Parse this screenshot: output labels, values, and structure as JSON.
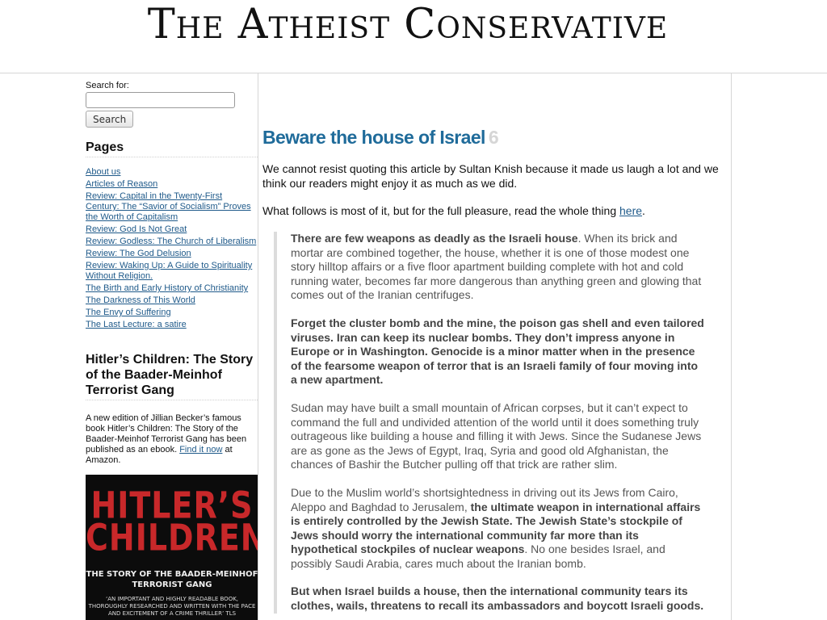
{
  "header": {
    "site_title": "The Atheist Conservative"
  },
  "sidebar": {
    "search_label": "Search for:",
    "search_value": "",
    "search_button": "Search",
    "pages_title": "Pages",
    "pages": [
      "About us",
      "Articles of Reason",
      "Review: Capital in the Twenty-First Century: The “Savior of Socialism” Proves the Worth of Capitalism",
      "Review: God Is Not Great",
      "Review: Godless: The Church of Liberalism",
      "Review: The God Delusion",
      "Review: Waking Up: A Guide to Spirituality Without Religion.",
      "The Birth and Early History of Christianity",
      "The Darkness of This World",
      "The Envy of Suffering",
      "The Last Lecture: a satire"
    ],
    "book_widget": {
      "title": "Hitler’s Children: The Story of the Baader-Meinhof Terrorist Gang",
      "desc_before": "A new edition of Jillian Becker’s famous book Hitler’s Children: The Story of the Baader-Meinhof Terrorist Gang has been published as an ebook. ",
      "desc_link": "Find it now",
      "desc_after": " at Amazon.",
      "cover": {
        "line1": "HITLER’S",
        "line2": "CHILDREN",
        "subtitle": "THE STORY OF THE BAADER-MEINHOF TERRORIST GANG",
        "quote": "‘AN IMPORTANT AND HIGHLY READABLE BOOK, THOROUGHLY RESEARCHED AND WRITTEN WITH THE PACE AND EXCITEMENT OF A CRIME THRILLER’ TLS",
        "title_color": "#c8282a"
      }
    }
  },
  "post": {
    "title": "Beware the house of Israel",
    "comment_count": "6",
    "intro1": "We cannot resist quoting this article by Sultan Knish because it made us laugh a lot and we think our readers might enjoy it as much as we did.",
    "intro2_before": "What follows is most of it, but for the full pleasure, read the whole thing ",
    "intro2_link": "here",
    "intro2_after": ".",
    "quote": {
      "p1_bold": "There are few weapons as deadly as the Israeli house",
      "p1_rest": ". When its brick and mortar are combined together, the house, whether it is one of those modest one story hilltop affairs or a five floor apartment building complete with hot and cold running water, becomes far more dangerous than anything green and glowing that comes out of the Iranian centrifuges.",
      "p2_bold": "Forget the cluster bomb and the mine, the poison gas shell and even tailored viruses. Iran can keep its nuclear bombs. They don’t impress anyone in Europe or in Washington. Genocide is a minor matter when in the presence of the fearsome weapon of terror that is an Israeli family of four moving into a new apartment.",
      "p3": "Sudan may have built a small mountain of African corpses, but it can’t expect to command the full and undivided attention of the world until it does something truly outrageous like building a house and filling it with Jews. Since the Sudanese Jews are as gone as the Jews of Egypt, Iraq, Syria and good old Afghanistan, the chances of Bashir the Butcher pulling off that trick are rather slim.",
      "p4_a": "Due to the Muslim world’s shortsightedness in driving out its Jews from Cairo, Aleppo and Baghdad  to Jerusalem, ",
      "p4_bold": "the ultimate weapon in international affairs is entirely controlled by the Jewish State. The Jewish State’s stockpile of Jews should worry the international community far more than its hypothetical stockpiles of nuclear weapons",
      "p4_c": ". No one besides Israel, and possibly Saudi Arabia, cares much about the Iranian bomb.",
      "p5_bold": "But when Israel builds a house, then the international community tears its clothes, wails, threatens to recall its ambassadors and boycott Israeli goods."
    }
  }
}
